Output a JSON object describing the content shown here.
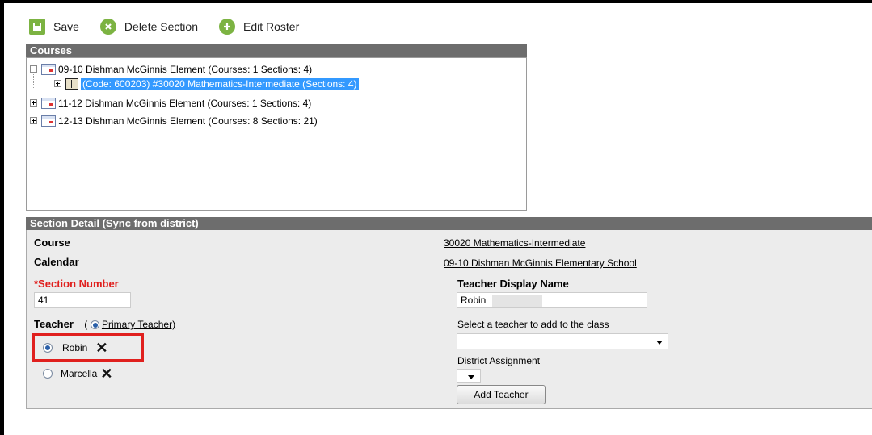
{
  "toolbar": {
    "save_label": "Save",
    "delete_label": "Delete Section",
    "edit_roster_label": "Edit Roster"
  },
  "courses": {
    "header": "Courses",
    "rows": [
      "09-10 Dishman McGinnis Element (Courses: 1 Sections: 4)",
      "(Code: 600203) #30020 Mathematics-Intermediate (Sections: 4)",
      "11-12 Dishman McGinnis Element (Courses: 1 Sections: 4)",
      "12-13 Dishman McGinnis Element (Courses: 8 Sections: 21)"
    ]
  },
  "detail": {
    "header": "Section Detail (Sync from district)",
    "course_label": "Course",
    "course_value": "30020 Mathematics-Intermediate",
    "calendar_label": "Calendar",
    "calendar_value": "09-10 Dishman McGinnis Elementary School",
    "section_number_label": "*Section Number",
    "section_number_value": "41",
    "teacher_display_label": "Teacher Display Name",
    "teacher_display_value": "Robin",
    "teacher_label": "Teacher",
    "paren_open": "(",
    "primary_teacher_label": "Primary Teacher)",
    "teachers": [
      "Robin",
      "Marcella"
    ],
    "select_teacher_label": "Select a teacher to add to the class",
    "district_assignment_label": "District Assignment",
    "add_teacher_label": "Add Teacher"
  },
  "colors": {
    "accent_green": "#7cb342",
    "header_gray": "#6d6d6d",
    "required_red": "#e0201e",
    "selection_blue": "#3399ff"
  }
}
